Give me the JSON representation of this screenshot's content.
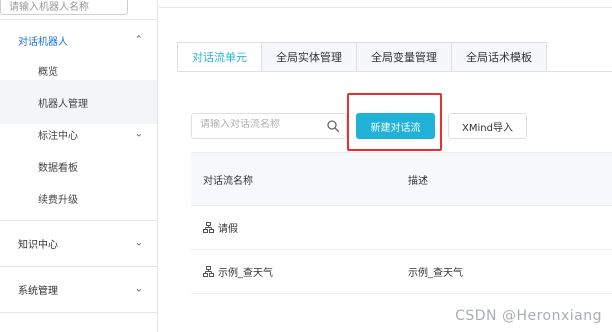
{
  "sidebar": {
    "search_placeholder": "请输入机器人名称",
    "items": [
      {
        "label": "对话机器人",
        "arrow": "⌃",
        "active": true
      },
      {
        "label": "概览"
      },
      {
        "label": "机器人管理"
      },
      {
        "label": "标注中心",
        "arrow": "⌄"
      },
      {
        "label": "数据看板"
      },
      {
        "label": "续费升级"
      },
      {
        "label": "知识中心",
        "arrow": "⌄"
      },
      {
        "label": "系统管理",
        "arrow": "⌄"
      }
    ]
  },
  "tabs": [
    {
      "label": "对话流单元"
    },
    {
      "label": "全局实体管理"
    },
    {
      "label": "全局变量管理"
    },
    {
      "label": "全局话术模板"
    }
  ],
  "toolbar": {
    "search_placeholder": "请输入对话流名称",
    "new_button": "新建对话流",
    "import_button": "XMind导入"
  },
  "table": {
    "headers": [
      "对话流名称",
      "描述"
    ],
    "rows": [
      {
        "name": "请假",
        "desc": ""
      },
      {
        "name": "示例_查天气",
        "desc": "示例_查天气"
      }
    ]
  },
  "watermark": "CSDN @Heronxiang"
}
